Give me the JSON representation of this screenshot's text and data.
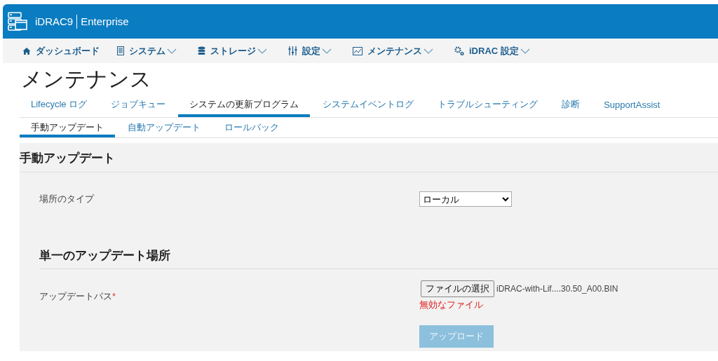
{
  "header": {
    "product": "iDRAC9",
    "edition": "Enterprise"
  },
  "nav": [
    {
      "label": "ダッシュボード",
      "has_menu": false
    },
    {
      "label": "システム",
      "has_menu": true
    },
    {
      "label": "ストレージ",
      "has_menu": true
    },
    {
      "label": "設定",
      "has_menu": true
    },
    {
      "label": "メンテナンス",
      "has_menu": true
    },
    {
      "label": "iDRAC 設定",
      "has_menu": true
    }
  ],
  "page_title": "メンテナンス",
  "tabs": [
    {
      "label": "Lifecycle ログ",
      "selected": false
    },
    {
      "label": "ジョブキュー",
      "selected": false
    },
    {
      "label": "システムの更新プログラム",
      "selected": true
    },
    {
      "label": "システムイベントログ",
      "selected": false
    },
    {
      "label": "トラブルシューティング",
      "selected": false
    },
    {
      "label": "診断",
      "selected": false
    },
    {
      "label": "SupportAssist",
      "selected": false
    }
  ],
  "subtabs": [
    {
      "label": "手動アップデート",
      "selected": true
    },
    {
      "label": "自動アップデート",
      "selected": false
    },
    {
      "label": "ロールバック",
      "selected": false
    }
  ],
  "panel": {
    "title": "手動アップデート",
    "location_type": {
      "label": "場所のタイプ",
      "value": "ローカル"
    },
    "section_title": "単一のアップデート場所",
    "update_path": {
      "label": "アップデートパス",
      "required_mark": "*",
      "choose_button": "ファイルの選択",
      "file_name": "iDRAC-with-Lif....30.50_A00.BIN",
      "error": "無効なファイル"
    },
    "upload_button": {
      "label": "アップロード",
      "disabled": true
    }
  }
}
